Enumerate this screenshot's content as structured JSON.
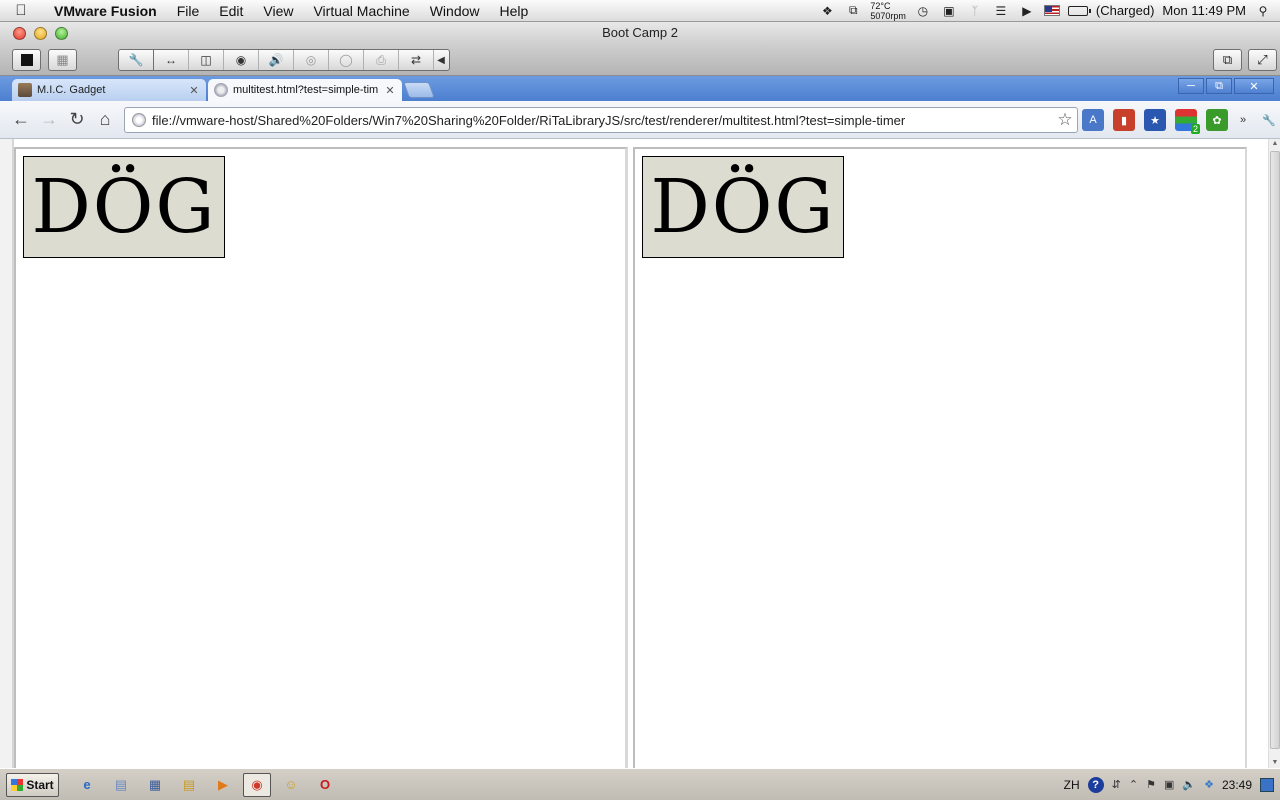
{
  "mac_menubar": {
    "app_name": "VMware Fusion",
    "menus": [
      "File",
      "Edit",
      "View",
      "Virtual Machine",
      "Window",
      "Help"
    ],
    "temp": "72°C",
    "fan": "5070rpm",
    "battery_status": "(Charged)",
    "clock": "Mon 11:49 PM"
  },
  "vm_window": {
    "title": "Boot Camp 2"
  },
  "browser": {
    "tabs": [
      {
        "title": "M.I.C. Gadget",
        "active": false
      },
      {
        "title": "multitest.html?test=simple-tim",
        "active": true
      }
    ],
    "url": "file://vmware-host/Shared%20Folders/Win7%20Sharing%20Folder/RiTaLibraryJS/src/test/renderer/multitest.html?test=simple-timer",
    "ext_badge": "2"
  },
  "page": {
    "left_panel_text": "DÖG",
    "right_panel_text": "DÖG"
  },
  "taskbar": {
    "start_label": "Start",
    "language": "ZH",
    "time": "23:49"
  },
  "colors": {
    "canvas_bg": "#dcdcd0",
    "tab_strip": "#5a8ad8"
  }
}
